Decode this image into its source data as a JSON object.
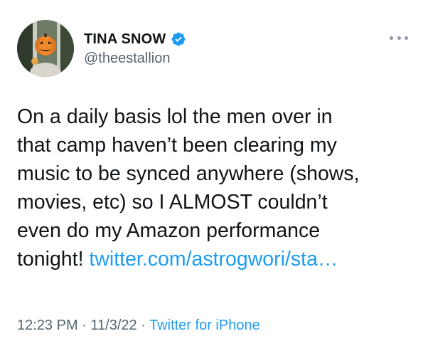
{
  "author": {
    "display_name": "TINA SNOW",
    "handle": "@theestallion",
    "verified_icon": "verified-badge-icon"
  },
  "menu": {
    "icon": "more-options-icon"
  },
  "tweet": {
    "text": "On a daily basis lol the men over in\nthat camp haven’t been clearing my\nmusic to be synced anywhere (shows,\nmovies, etc) so I ALMOST couldn’t\neven do my Amazon performance\ntonight! ",
    "link": "twitter.com/astrogwori/sta…"
  },
  "meta": {
    "time": "12:23 PM",
    "sep1": " · ",
    "date": "11/3/22",
    "sep2": " · ",
    "source": "Twitter for iPhone"
  },
  "colors": {
    "accent": "#1d9bf0",
    "secondary_text": "#536471",
    "primary_text": "#0f1419"
  }
}
